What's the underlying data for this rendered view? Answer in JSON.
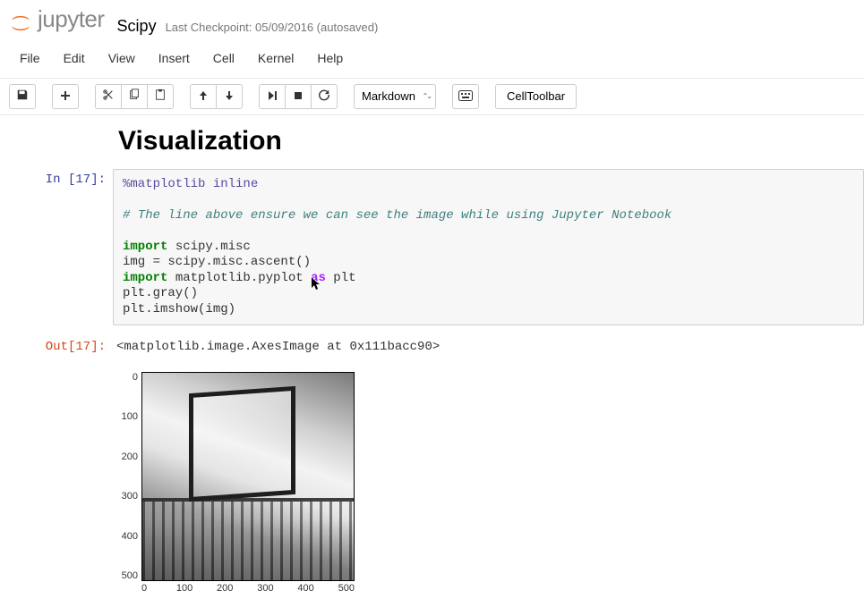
{
  "header": {
    "logo_text": "jupyter",
    "notebook_title": "Scipy",
    "checkpoint": "Last Checkpoint: 05/09/2016 (autosaved)"
  },
  "menubar": {
    "items": [
      "File",
      "Edit",
      "View",
      "Insert",
      "Cell",
      "Kernel",
      "Help"
    ]
  },
  "toolbar": {
    "save_title": "Save and Checkpoint",
    "add_title": "Insert Cell Below",
    "cut_title": "Cut",
    "copy_title": "Copy",
    "paste_title": "Paste",
    "up_title": "Move Cell Up",
    "down_title": "Move Cell Down",
    "run_title": "Run Cell",
    "stop_title": "Interrupt Kernel",
    "restart_title": "Restart Kernel",
    "cell_type_selected": "Markdown",
    "cmd_palette_title": "Command Palette",
    "cell_toolbar_label": "CellToolbar"
  },
  "cells": {
    "heading": "Visualization",
    "in_prompt": "In [17]:",
    "out_prompt": "Out[17]:",
    "code": {
      "magic": "%matplotlib inline",
      "blank1": "",
      "comment": "# The line above ensure we can see the image while using Jupyter Notebook",
      "blank2": "",
      "l1a": "import",
      "l1b": " scipy.misc",
      "l2": "img = scipy.misc.ascent()",
      "l3a": "import",
      "l3b": " matplotlib.pyplot ",
      "l3c": "as",
      "l3d": " plt",
      "l4": "plt.gray()",
      "l5": "plt.imshow(img)"
    },
    "out_text": "<matplotlib.image.AxesImage at 0x111bacc90>"
  },
  "chart_data": {
    "type": "image",
    "title": "",
    "xlabel": "",
    "ylabel": "",
    "xticks": [
      0,
      100,
      200,
      300,
      400,
      500
    ],
    "yticks": [
      0,
      100,
      200,
      300,
      400,
      500
    ],
    "xlim": [
      0,
      512
    ],
    "ylim": [
      512,
      0
    ],
    "image_description": "scipy.misc.ascent() grayscale image (staircase scene)",
    "colormap": "gray"
  }
}
